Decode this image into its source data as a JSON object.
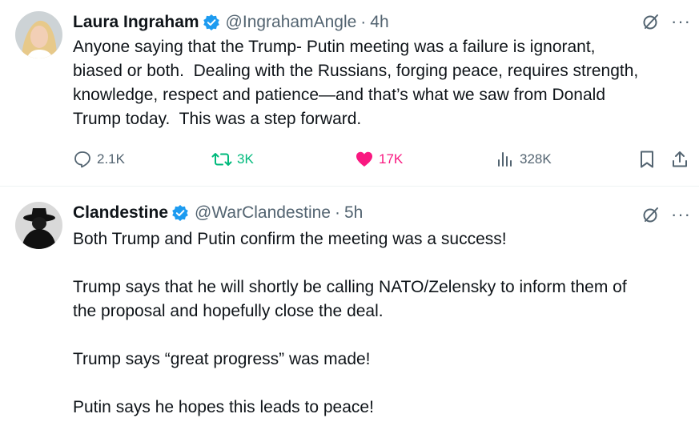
{
  "tweets": [
    {
      "name": "Laura Ingraham",
      "handle": "@IngrahamAngle",
      "separator": "·",
      "time": "4h",
      "text": "Anyone saying that the Trump- Putin meeting was a failure is ignorant,\nbiased or both.  Dealing with the Russians, forging peace, requires strength,\nknowledge, respect and patience—and that’s what we saw from Donald\nTrump today.  This was a step forward.",
      "replies": "2.1K",
      "reposts": "3K",
      "likes": "17K",
      "views": "328K"
    },
    {
      "name": "Clandestine",
      "handle": "@WarClandestine",
      "separator": "·",
      "time": "5h",
      "text": "Both Trump and Putin confirm the meeting was a success!\n\nTrump says that he will shortly be calling NATO/Zelensky to inform them of\nthe proposal and hopefully close the deal.\n\nTrump says “great progress” was made!\n\nPutin says he hopes this leads to peace!"
    }
  ],
  "more_label": "···",
  "colors": {
    "verified": "#1d9bf0",
    "like": "#f91880",
    "repost": "#00ba7c",
    "muted": "#536471"
  }
}
